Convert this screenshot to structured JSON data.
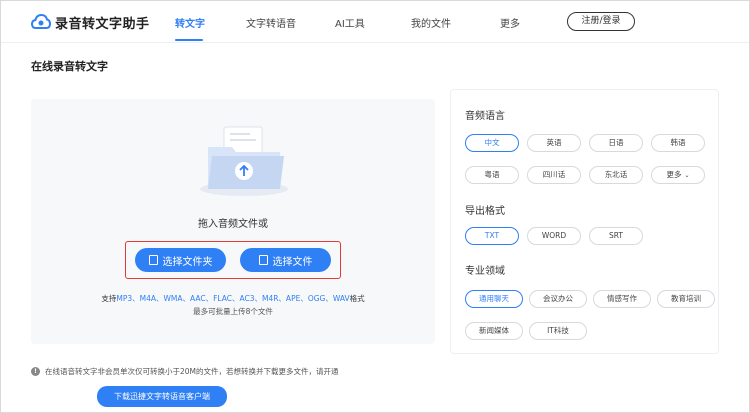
{
  "app": {
    "name": "录音转文字助手",
    "accent": "#2f7ff5"
  },
  "nav": {
    "items": [
      {
        "label": "转文字",
        "active": true
      },
      {
        "label": "文字转语音",
        "active": false
      },
      {
        "label": "AI工具",
        "active": false
      },
      {
        "label": "我的文件",
        "active": false
      },
      {
        "label": "更多",
        "active": false
      }
    ],
    "login_label": "注册/登录"
  },
  "page": {
    "title": "在线录音转文字"
  },
  "upload": {
    "drop_text": "拖入音频文件或",
    "select_folder_label": "选择文件夹",
    "select_file_label": "选择文件",
    "formats_prefix": "支持",
    "formats": "MP3、M4A、WMA、AAC、FLAC、AC3、M4R、APE、OGG、WAV",
    "formats_suffix": "格式",
    "batch_text": "最多可批量上传8个文件"
  },
  "settings": {
    "language": {
      "title": "音频语言",
      "options": [
        "中文",
        "英语",
        "日语",
        "韩语",
        "粤语",
        "四川话",
        "东北话",
        "更多"
      ],
      "selected": "中文"
    },
    "export": {
      "title": "导出格式",
      "options": [
        "TXT",
        "WORD",
        "SRT"
      ],
      "selected": "TXT"
    },
    "domain": {
      "title": "专业领域",
      "options": [
        "通用聊天",
        "会议办公",
        "情感写作",
        "教育培训",
        "新闻媒体",
        "IT科技"
      ],
      "selected": "通用聊天"
    }
  },
  "footer": {
    "notice": "在线语音转文字非会员单次仅可转换小于20M的文件，若想转换并下载更多文件，请开通",
    "download_label": "下载迅捷文字转语音客户端"
  }
}
